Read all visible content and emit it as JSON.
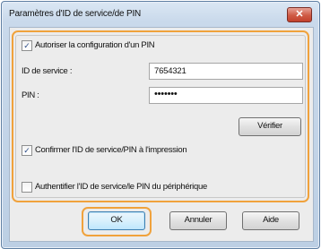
{
  "dialog": {
    "title": "Paramètres d'ID de service/de PIN",
    "close_glyph": "✕"
  },
  "pin_config": {
    "checkbox_label": "Autoriser la configuration d'un PIN",
    "checked": true,
    "service_id_label": "ID de service :",
    "service_id_value": "7654321",
    "pin_label": "PIN :",
    "pin_value": "•••••••",
    "verify_button": "Vérifier"
  },
  "confirm_print": {
    "label": "Confirmer l'ID de service/PIN à l'impression",
    "checked": true
  },
  "auth_device": {
    "label": "Authentifier l'ID de service/le PIN du périphérique",
    "checked": false
  },
  "buttons": {
    "ok": "OK",
    "cancel": "Annuler",
    "help": "Aide"
  },
  "colors": {
    "highlight": "#f0a23c",
    "close_button": "#cf5a45",
    "check_mark": "#2c4d87"
  }
}
